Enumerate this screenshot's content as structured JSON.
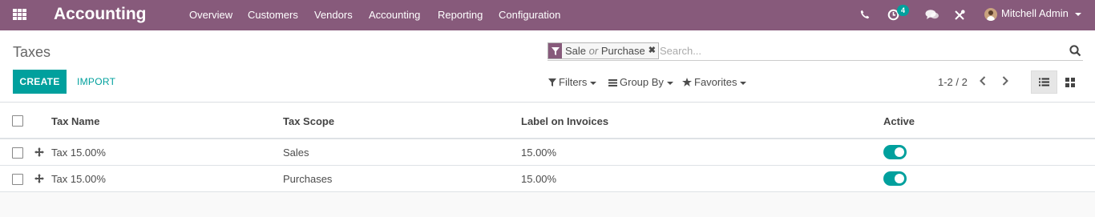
{
  "navbar": {
    "app_title": "Accounting",
    "menu": [
      "Overview",
      "Customers",
      "Vendors",
      "Accounting",
      "Reporting",
      "Configuration"
    ],
    "activity_count": "4",
    "user_name": "Mitchell Admin",
    "icons": [
      "apps-grid-icon",
      "phone-icon",
      "activity-clock-icon",
      "chat-icon",
      "tools-icon",
      "avatar",
      "chevron-down-icon"
    ]
  },
  "control_panel": {
    "title": "Taxes",
    "search": {
      "facet_a": "Sale",
      "facet_or": "or",
      "facet_b": "Purchase",
      "placeholder": "Search..."
    },
    "buttons": {
      "create": "CREATE",
      "import": "IMPORT"
    },
    "dropdowns": {
      "filters": "Filters",
      "group_by": "Group By",
      "favorites": "Favorites"
    },
    "pager": "1-2 / 2"
  },
  "table": {
    "columns": [
      "Tax Name",
      "Tax Scope",
      "Label on Invoices",
      "Active"
    ],
    "rows": [
      {
        "name": "Tax 15.00%",
        "scope": "Sales",
        "label": "15.00%",
        "active": true
      },
      {
        "name": "Tax 15.00%",
        "scope": "Purchases",
        "label": "15.00%",
        "active": true
      }
    ]
  },
  "colors": {
    "navbar": "#875a7b",
    "accent": "#00a09d"
  }
}
